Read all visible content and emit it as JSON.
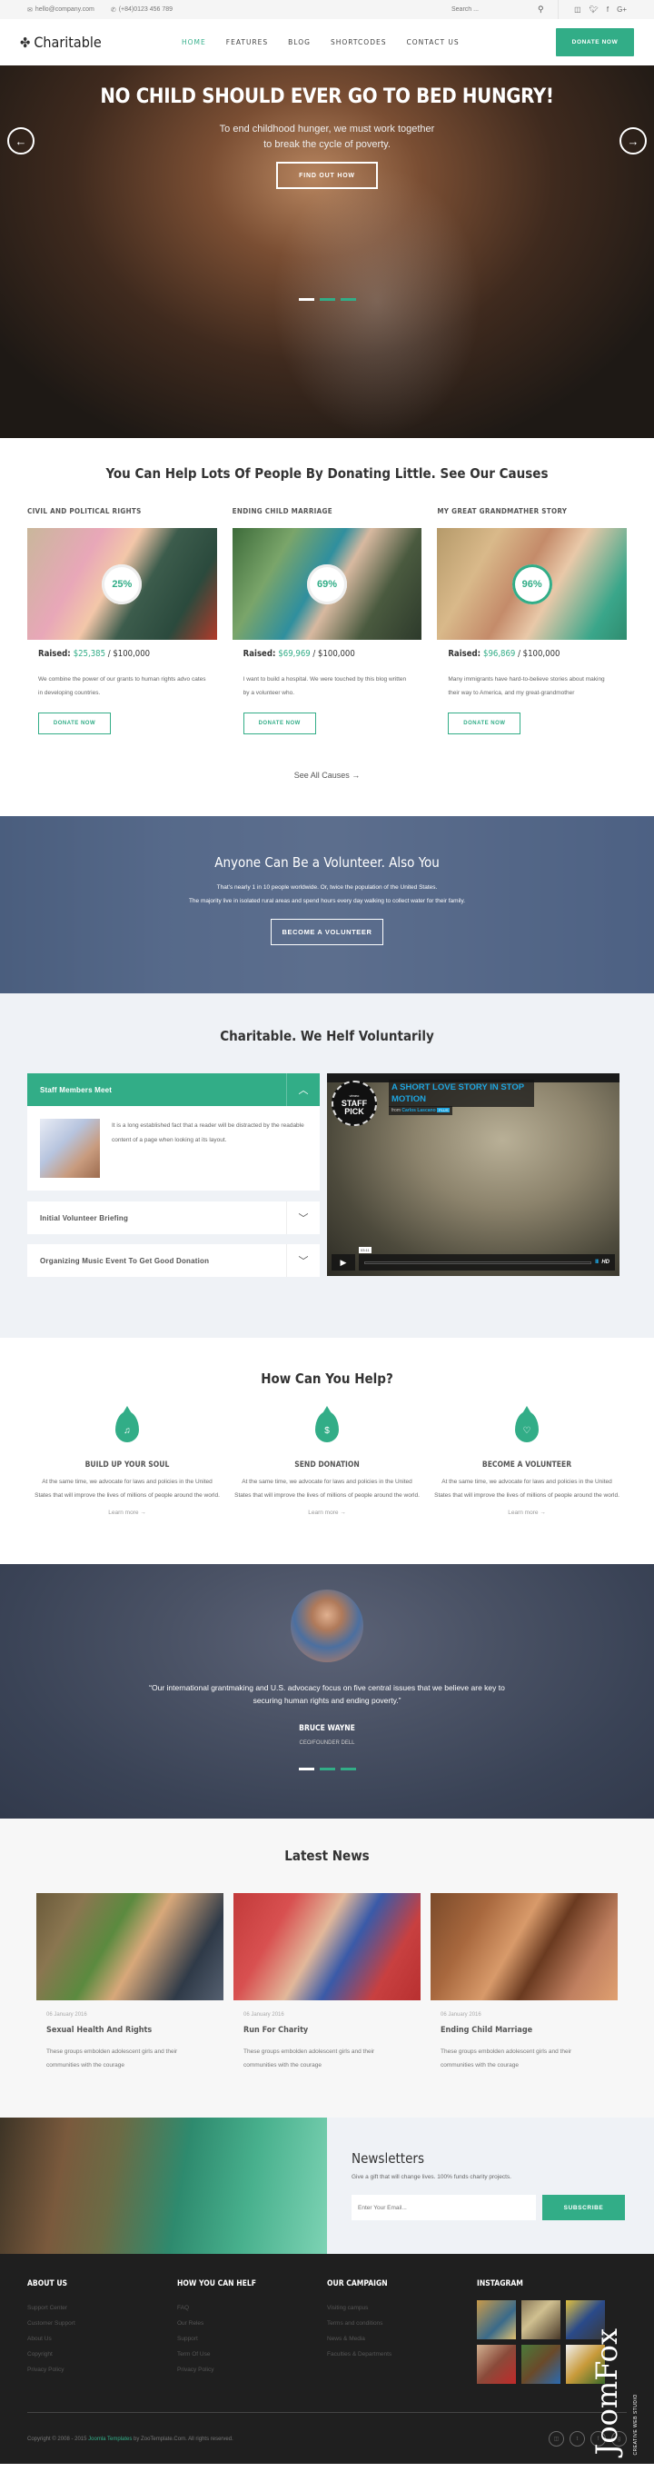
{
  "topbar": {
    "email": "hello@company.com",
    "phone": "(+84)0123 456 789",
    "search_placeholder": "Search ...",
    "social": [
      "instagram-icon",
      "twitter-icon",
      "facebook-icon",
      "google-plus-icon"
    ]
  },
  "header": {
    "logo": "Charitable",
    "nav": [
      "HOME",
      "FEATURES",
      "BLOG",
      "SHORTCODES",
      "CONTACT US"
    ],
    "active_nav": "HOME",
    "donate_label": "DONATE NOW"
  },
  "hero": {
    "title": "NO CHILD SHOULD EVER GO TO BED HUNGRY!",
    "subtitle_line1": "To end childhood hunger, we must work together",
    "subtitle_line2": "to break the cycle of poverty.",
    "cta": "FIND OUT HOW",
    "prev": "←",
    "next": "→",
    "active_slide": 1,
    "slide_count": 3
  },
  "causes": {
    "title": "You Can Help Lots Of People By Donating Little. See Our Causes",
    "items": [
      {
        "title": "CIVIL AND POLITICAL RIGHTS",
        "percent": "25%",
        "raised_label": "Raised:",
        "raised": "$25,385",
        "goal": " / $100,000",
        "desc": "We combine the power of our grants to human rights advo cates in developing countries.",
        "button": "DONATE NOW"
      },
      {
        "title": "ENDING CHILD MARRIAGE",
        "percent": "69%",
        "raised_label": "Raised:",
        "raised": "$69,969",
        "goal": " / $100,000",
        "desc": "I want to build a hospital. We were touched by this blog written by a volunteer who.",
        "button": "DONATE NOW"
      },
      {
        "title": "MY GREAT GRANDMATHER STORY",
        "percent": "96%",
        "raised_label": "Raised:",
        "raised": "$96,869",
        "goal": " / $100,000",
        "desc": "Many immigrants have hard-to-believe stories about making their way to America, and my great-grandmother",
        "button": "DONATE NOW"
      }
    ],
    "see_all": "See All Causes →"
  },
  "volunteer": {
    "title": "Anyone Can Be a Volunteer. Also You",
    "line1": "That’s nearly 1 in 10 people worldwide. Or, twice the population of the United States.",
    "line2": "The majority live in isolated rural areas and spend hours every day walking to collect water for their family.",
    "cta": "BECOME A VOLUNTEER"
  },
  "helf": {
    "title": "Charitable. We Helf Voluntarily",
    "accordion": [
      {
        "title": "Staff Members Meet",
        "open": true,
        "body": "It is a long established fact that a reader will be distracted by the readable content of a page when looking at its layout."
      },
      {
        "title": "Initial Volunteer Briefing",
        "open": false
      },
      {
        "title": "Organizing Music Event To Get Good Donation",
        "open": false
      }
    ],
    "video": {
      "badge_top": "vimeo",
      "badge_line1": "STAFF",
      "badge_line2": "PICK",
      "title": "A SHORT LOVE STORY IN STOP MOTION",
      "from_label": "from",
      "author": "Carlos Lascano",
      "author_badge": "PLUS",
      "time": "03:11",
      "hd": "HD",
      "volume": "IIIII"
    }
  },
  "how": {
    "title": "How Can You Help?",
    "items": [
      {
        "icon": "🔔",
        "title": "BUILD UP YOUR SOUL",
        "desc": "At the same time, we advocate for laws and policies in the United States that will improve the lives of millions of people around the world.",
        "link": "Learn more →"
      },
      {
        "icon": "$",
        "title": "SEND DONATION",
        "desc": "At the same time, we advocate for laws and policies in the United States that will improve the lives of millions of people around the world.",
        "link": "Learn more →"
      },
      {
        "icon": "♡",
        "title": "BECOME A VOLUNTEER",
        "desc": "At the same time, we advocate for laws and policies in the United States that will improve the lives of millions of people around the world.",
        "link": "Learn more →"
      }
    ]
  },
  "testimonial": {
    "quote": "“Our international grantmaking and U.S. advocacy focus on five central issues that we believe are key to securing human rights and ending poverty.”",
    "name": "BRUCE WAYNE",
    "role": "CEO/FOUNDER DELL",
    "active_slide": 1,
    "slide_count": 3
  },
  "news": {
    "title": "Latest News",
    "items": [
      {
        "date": "06 January 2016",
        "title": "Sexual Health And Rights",
        "desc": "These groups embolden adolescent girls and their communities with the courage"
      },
      {
        "date": "06 January 2016",
        "title": "Run For Charity",
        "desc": "These groups embolden adolescent girls and their communities with the courage"
      },
      {
        "date": "06 January 2016",
        "title": "Ending Child Marriage",
        "desc": "These groups embolden adolescent girls and their communities with the courage"
      }
    ]
  },
  "newsletter": {
    "title": "Newsletters",
    "desc": "Give a gift that will change lives. 100% funds charity projects.",
    "placeholder": "Enter Your Email...",
    "button": "SUBSCRIBE"
  },
  "footer": {
    "columns": [
      {
        "title": "ABOUT US",
        "links": [
          "Support Center",
          "Customer Support",
          "About Us",
          "Copyright",
          "Privacy Policy"
        ]
      },
      {
        "title": "HOW YOU CAN HELF",
        "links": [
          "FAQ",
          "Our Reles",
          "Support",
          "Term Of Use",
          "Privacy Policy"
        ]
      },
      {
        "title": "OUR CAMPAIGN",
        "links": [
          "Visiting campus",
          "Terms and conditions",
          "News & Media",
          "Faculties & Departments"
        ]
      }
    ],
    "instagram_title": "INSTAGRAM",
    "copyright_prefix": "Copyright © 2008 - 2015 ",
    "copyright_link": "Joomla Templates",
    "copyright_suffix": " by ZooTemplate.Com. All rights reserved.",
    "social": [
      "instagram-icon",
      "twitter-icon",
      "facebook-icon",
      "google-plus-icon"
    ],
    "watermark": "JoomFox",
    "watermark_sub": "CREATIVE WEB STUDIO"
  },
  "colors": {
    "accent": "#32ad87",
    "footer_bg": "#1f1f1f",
    "section_bg": "#eff2f6",
    "video_title": "#1ea5e0"
  }
}
